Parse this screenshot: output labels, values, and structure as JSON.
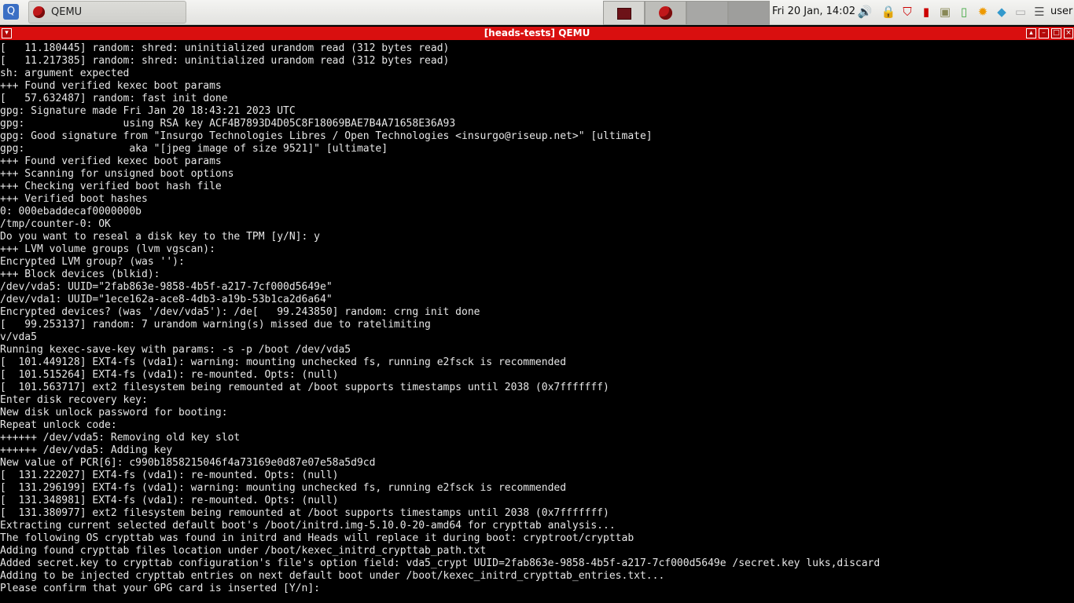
{
  "panel": {
    "menu_icon": "menu-icon",
    "task_label": "QEMU",
    "clock": "Fri 20 Jan, 14:02",
    "user": "user",
    "tray_icons": [
      "volume-icon",
      "lock-icon",
      "shield-icon",
      "signal-icon",
      "monitor-icon",
      "battery-icon",
      "weather-icon",
      "cube-icon",
      "disk-icon",
      "list-icon"
    ]
  },
  "window": {
    "title": "[heads-tests] QEMU"
  },
  "terminal": {
    "lines": [
      "[   11.180445] random: shred: uninitialized urandom read (312 bytes read)",
      "[   11.217385] random: shred: uninitialized urandom read (312 bytes read)",
      "sh: argument expected",
      "+++ Found verified kexec boot params",
      "[   57.632487] random: fast init done",
      "gpg: Signature made Fri Jan 20 18:43:21 2023 UTC",
      "gpg:                using RSA key ACF4B7893D4D05C8F18069BAE7B4A71658E36A93",
      "gpg: Good signature from \"Insurgo Technologies Libres / Open Technologies <insurgo@riseup.net>\" [ultimate]",
      "gpg:                 aka \"[jpeg image of size 9521]\" [ultimate]",
      "+++ Found verified kexec boot params",
      "+++ Scanning for unsigned boot options",
      "+++ Checking verified boot hash file",
      "+++ Verified boot hashes",
      "0: 000ebaddecaf0000000b",
      "/tmp/counter-0: OK",
      "Do you want to reseal a disk key to the TPM [y/N]: y",
      "+++ LVM volume groups (lvm vgscan):",
      "Encrypted LVM group? (was ''):",
      "+++ Block devices (blkid):",
      "/dev/vda5: UUID=\"2fab863e-9858-4b5f-a217-7cf000d5649e\"",
      "/dev/vda1: UUID=\"1ece162a-ace8-4db3-a19b-53b1ca2d6a64\"",
      "Encrypted devices? (was '/dev/vda5'): /de[   99.243850] random: crng init done",
      "[   99.253137] random: 7 urandom warning(s) missed due to ratelimiting",
      "v/vda5",
      "Running kexec-save-key with params: -s -p /boot /dev/vda5",
      "[  101.449128] EXT4-fs (vda1): warning: mounting unchecked fs, running e2fsck is recommended",
      "[  101.515264] EXT4-fs (vda1): re-mounted. Opts: (null)",
      "[  101.563717] ext2 filesystem being remounted at /boot supports timestamps until 2038 (0x7fffffff)",
      "Enter disk recovery key:",
      "New disk unlock password for booting:",
      "Repeat unlock code:",
      "++++++ /dev/vda5: Removing old key slot",
      "++++++ /dev/vda5: Adding key",
      "New value of PCR[6]: c990b1858215046f4a73169e0d87e07e58a5d9cd",
      "[  131.222027] EXT4-fs (vda1): re-mounted. Opts: (null)",
      "[  131.296199] EXT4-fs (vda1): warning: mounting unchecked fs, running e2fsck is recommended",
      "[  131.348981] EXT4-fs (vda1): re-mounted. Opts: (null)",
      "[  131.380977] ext2 filesystem being remounted at /boot supports timestamps until 2038 (0x7fffffff)",
      "Extracting current selected default boot's /boot/initrd.img-5.10.0-20-amd64 for crypttab analysis...",
      "The following OS crypttab was found in initrd and Heads will replace it during boot: cryptroot/crypttab",
      "Adding found crypttab files location under /boot/kexec_initrd_crypttab_path.txt",
      "Added secret.key to crypttab configuration's file's option field: vda5_crypt UUID=2fab863e-9858-4b5f-a217-7cf000d5649e /secret.key luks,discard",
      "Adding to be injected crypttab entries on next default boot under /boot/kexec_initrd_crypttab_entries.txt...",
      "Please confirm that your GPG card is inserted [Y/n]:"
    ]
  }
}
